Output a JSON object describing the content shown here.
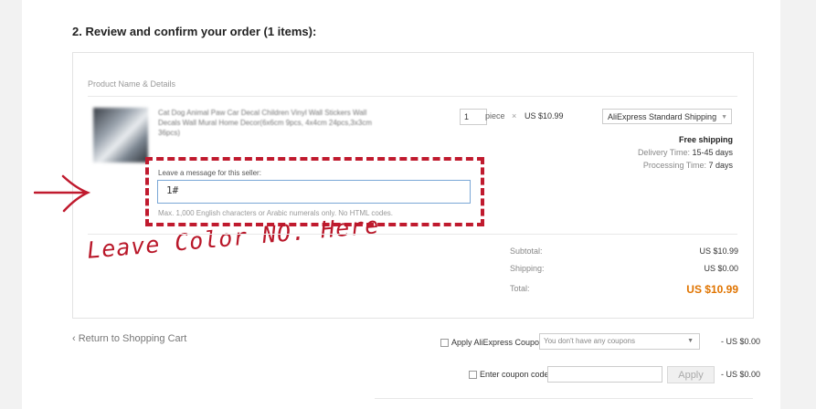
{
  "section": {
    "title": "2. Review and confirm your order (1 items):"
  },
  "table": {
    "column_header": "Product Name & Details"
  },
  "product": {
    "name": "Cat Dog Animal Paw Car Decal Children Vinyl Wall Stickers Wall Decals Wall Mural Home Decor(6x6cm 9pcs, 4x4cm 24pcs,3x3cm 36pcs)",
    "quantity": "1",
    "unit": "piece",
    "times": "×",
    "price": "US $10.99"
  },
  "shipping": {
    "method": "AliExpress Standard Shipping",
    "free_label": "Free shipping",
    "delivery_label": "Delivery Time:",
    "delivery_value": "15-45 days",
    "processing_label": "Processing Time:",
    "processing_value": "7 days"
  },
  "message": {
    "label": "Leave a message for this seller:",
    "value": "1#",
    "hint": "Max. 1,000 English characters or Arabic numerals only. No HTML codes."
  },
  "annotation": {
    "text": "Leave Color NO. Here",
    "color": "#b91729"
  },
  "summary": {
    "subtotal_label": "Subtotal:",
    "subtotal_value": "US $10.99",
    "shipping_label": "Shipping:",
    "shipping_value": "US $0.00",
    "total_label": "Total:",
    "total_value": "US $10.99"
  },
  "footer": {
    "return_link": "‹ Return to Shopping Cart",
    "coupon_label": "Apply AliExpress Coupon:",
    "coupon_select": "You don't have any coupons",
    "coupon_discount": "- US $0.00",
    "code_label": "Enter coupon code:",
    "apply_button": "Apply",
    "code_discount": "- US $0.00"
  },
  "colors": {
    "accent_total": "#e07400",
    "annotation_red": "#c01a2e",
    "input_focus": "#7aa7d6"
  },
  "icons": {
    "dropdown": "chevron-down-icon",
    "arrow": "right-arrow-icon"
  }
}
